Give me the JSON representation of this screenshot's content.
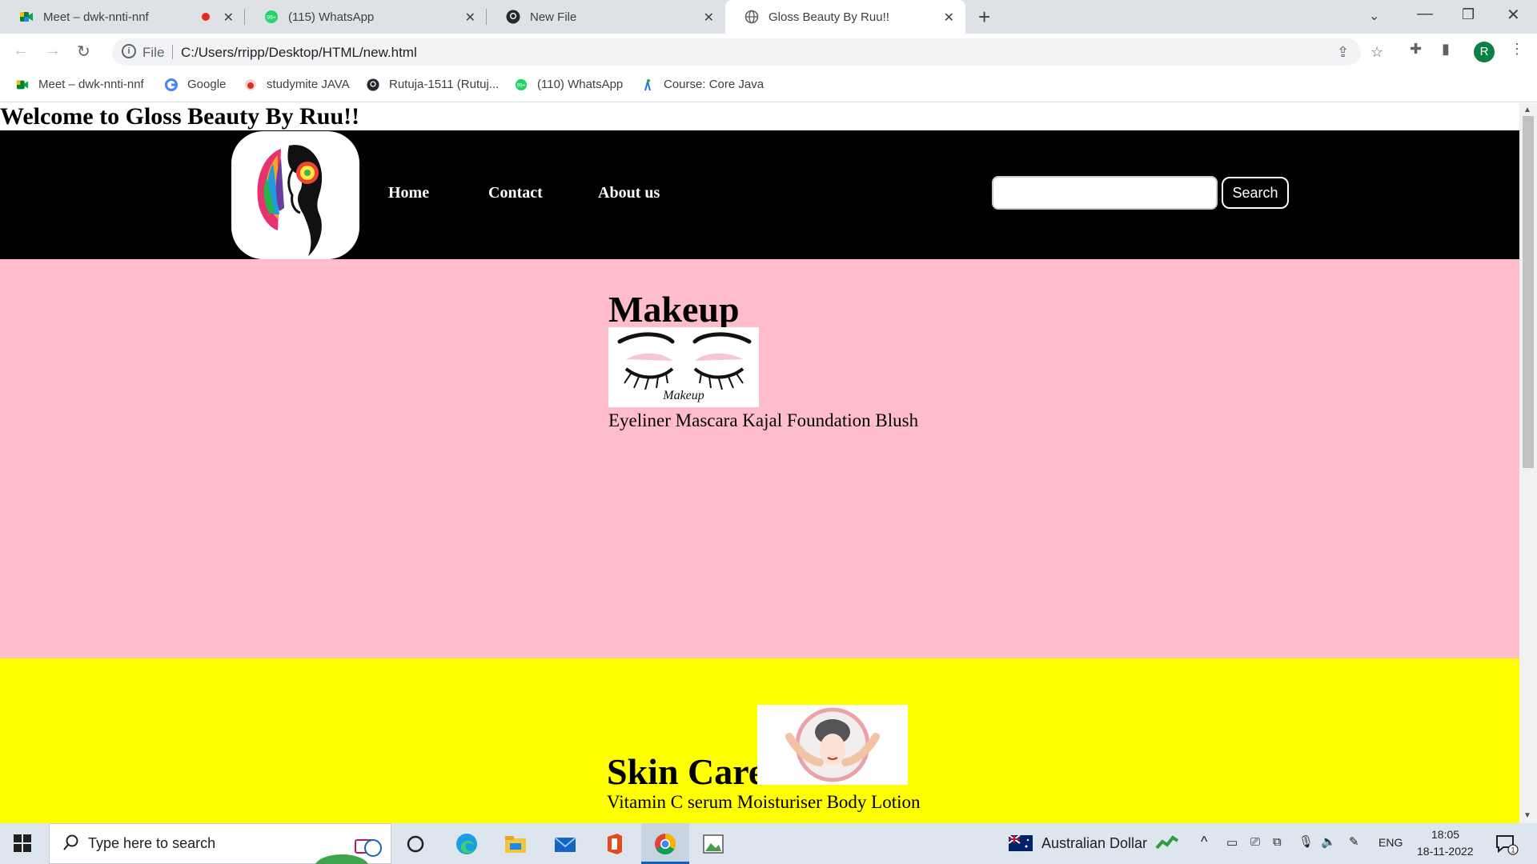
{
  "browser": {
    "tabs": [
      {
        "title": "Meet – dwk-nnti-nnf",
        "icon": "google-meet-icon",
        "recording": true
      },
      {
        "title": "(115) WhatsApp",
        "icon": "whatsapp-icon"
      },
      {
        "title": "New File",
        "icon": "github-icon"
      },
      {
        "title": "Gloss Beauty By Ruu!!",
        "icon": "globe-icon",
        "active": true
      }
    ],
    "address": {
      "scheme_label": "File",
      "url": "C:/Users/rripp/Desktop/HTML/new.html"
    },
    "profile_initial": "R",
    "bookmarks": [
      {
        "label": "Meet – dwk-nnti-nnf",
        "icon": "google-meet-icon"
      },
      {
        "label": "Google",
        "icon": "google-icon"
      },
      {
        "label": "studymite JAVA",
        "icon": "studymite-icon"
      },
      {
        "label": "Rutuja-1511 (Rutuj...",
        "icon": "github-icon"
      },
      {
        "label": "(110) WhatsApp",
        "icon": "whatsapp-icon"
      },
      {
        "label": "Course: Core Java",
        "icon": "course-icon"
      }
    ]
  },
  "page": {
    "welcome": "Welcome to Gloss Beauty By Ruu!!",
    "nav": {
      "links": [
        "Home",
        "Contact",
        "About us"
      ],
      "search_value": "",
      "search_button": "Search"
    },
    "makeup": {
      "title": "Makeup",
      "image_caption": "Makeup",
      "items": "Eyeliner Mascara Kajal Foundation Blush",
      "background": "#ffbcca"
    },
    "skincare": {
      "title": "Skin Care",
      "items": "Vitamin C serum Moisturiser Body Lotion",
      "background": "#ffff00"
    }
  },
  "taskbar": {
    "search_placeholder": "Type here to search",
    "currency": "Australian Dollar",
    "language": "ENG",
    "time": "18:05",
    "date": "18-11-2022",
    "notification_count": "1"
  }
}
